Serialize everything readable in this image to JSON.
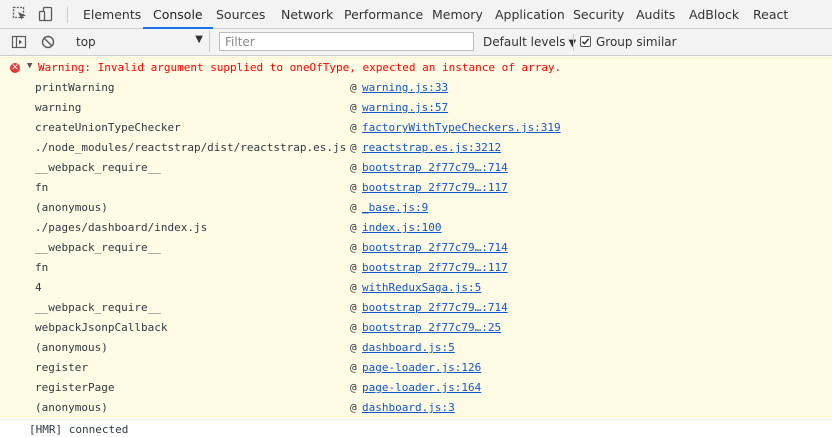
{
  "tabs": [
    {
      "label": "Elements"
    },
    {
      "label": "Console"
    },
    {
      "label": "Sources"
    },
    {
      "label": "Network"
    },
    {
      "label": "Performance"
    },
    {
      "label": "Memory"
    },
    {
      "label": "Application"
    },
    {
      "label": "Security"
    },
    {
      "label": "Audits"
    },
    {
      "label": "AdBlock"
    },
    {
      "label": "React"
    }
  ],
  "active_tab": "Console",
  "toolbar": {
    "context": "top",
    "filter_placeholder": "Filter",
    "levels": "Default levels",
    "group_similar_label": "Group similar",
    "group_similar_checked": true
  },
  "console": {
    "warning": {
      "message": "Warning: Invalid argument supplied to oneOfType, expected an instance of array.",
      "stack": [
        {
          "fn": "printWarning",
          "src": "warning.js:33"
        },
        {
          "fn": "warning",
          "src": "warning.js:57"
        },
        {
          "fn": "createUnionTypeChecker",
          "src": "factoryWithTypeCheckers.js:319"
        },
        {
          "fn": "./node_modules/reactstrap/dist/reactstrap.es.js",
          "src": "reactstrap.es.js:3212"
        },
        {
          "fn": "__webpack_require__",
          "src": "bootstrap 2f77c79…:714"
        },
        {
          "fn": "fn",
          "src": "bootstrap 2f77c79…:117"
        },
        {
          "fn": "(anonymous)",
          "src": "_base.js:9"
        },
        {
          "fn": "./pages/dashboard/index.js",
          "src": "index.js:100"
        },
        {
          "fn": "__webpack_require__",
          "src": "bootstrap 2f77c79…:714"
        },
        {
          "fn": "fn",
          "src": "bootstrap 2f77c79…:117"
        },
        {
          "fn": "4",
          "src": "withReduxSaga.js:5"
        },
        {
          "fn": "__webpack_require__",
          "src": "bootstrap 2f77c79…:714"
        },
        {
          "fn": "webpackJsonpCallback",
          "src": "bootstrap 2f77c79…:25"
        },
        {
          "fn": "(anonymous)",
          "src": "dashboard.js:5"
        },
        {
          "fn": "register",
          "src": "page-loader.js:126"
        },
        {
          "fn": "registerPage",
          "src": "page-loader.js:164"
        },
        {
          "fn": "(anonymous)",
          "src": "dashboard.js:3"
        }
      ]
    },
    "log": "[HMR] connected"
  },
  "colors": {
    "warning_text": "#ff0000",
    "warning_bg": "#fffbe5",
    "link": "#1155cc",
    "accent": "#1a73e8"
  }
}
